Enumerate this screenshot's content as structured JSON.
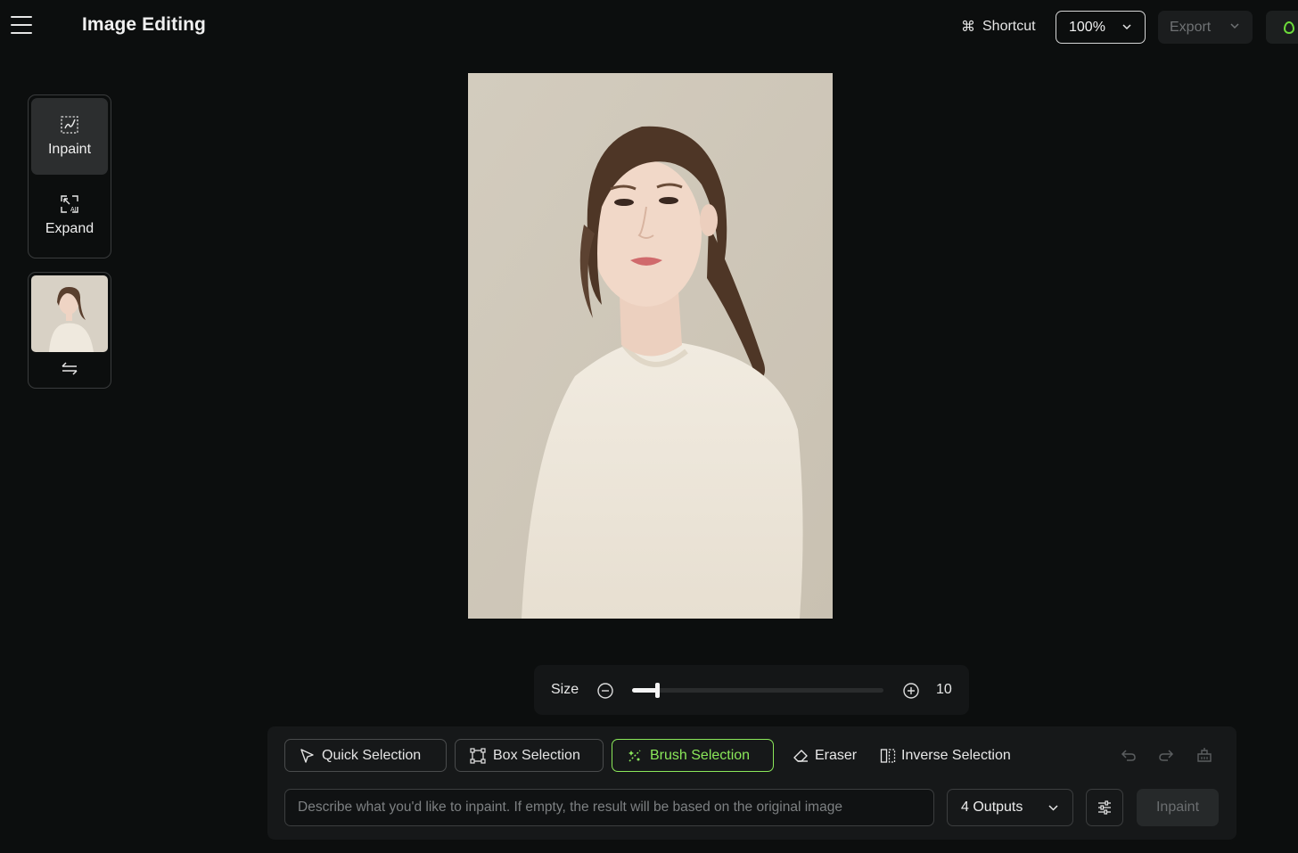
{
  "header": {
    "title": "Image Editing",
    "shortcut_label": "Shortcut",
    "zoom_value": "100%",
    "export_label": "Export"
  },
  "tools": [
    {
      "label": "Inpaint",
      "icon": "inpaint-icon",
      "active": true
    },
    {
      "label": "Expand",
      "icon": "expand-icon",
      "active": false
    }
  ],
  "size_control": {
    "label": "Size",
    "value": "10",
    "level_fraction": 0.1
  },
  "selection_tools": {
    "quick": "Quick Selection",
    "box": "Box Selection",
    "brush": "Brush Selection",
    "eraser": "Eraser",
    "inverse": "Inverse Selection",
    "active": "brush"
  },
  "prompt": {
    "placeholder": "Describe what you'd like to inpaint. If empty, the result will be based on the original image",
    "value": ""
  },
  "outputs": {
    "selected": "4 Outputs"
  },
  "actions": {
    "inpaint_label": "Inpaint"
  },
  "colors": {
    "accent": "#8be85a",
    "background": "#0c0e0e",
    "panel": "#161819"
  }
}
